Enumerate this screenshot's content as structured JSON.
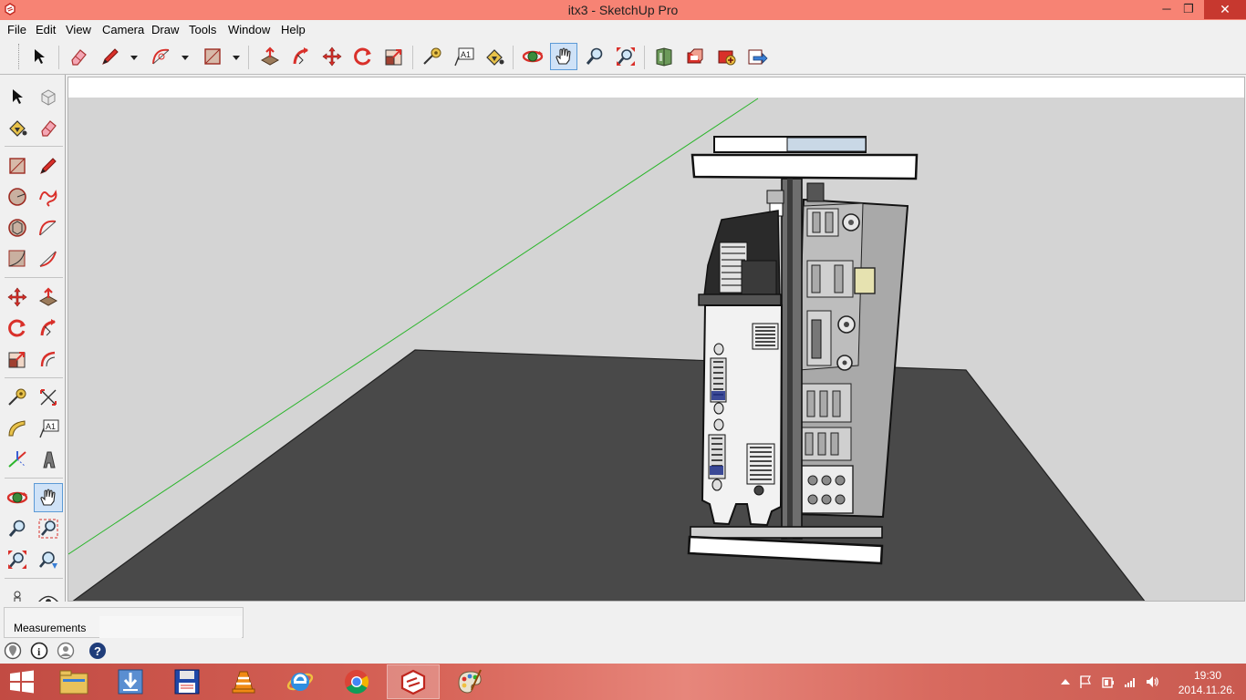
{
  "window": {
    "title": "itx3 - SketchUp Pro",
    "minimize": "─",
    "maximize": "❐",
    "close": "✕"
  },
  "menu": [
    "File",
    "Edit",
    "View",
    "Camera",
    "Draw",
    "Tools",
    "Window",
    "Help"
  ],
  "toolbar": {
    "tools": [
      "select",
      "eraser",
      "line",
      "arc",
      "rectangle",
      "push-pull",
      "follow-me",
      "move",
      "rotate",
      "scale",
      "tape-measure",
      "text",
      "paint-bucket",
      "orbit",
      "pan",
      "zoom",
      "zoom-extents",
      "3d-warehouse",
      "share-model",
      "extension-warehouse",
      "send-to-layout"
    ],
    "active_tool": "pan",
    "text_tool_label": "A1"
  },
  "left_toolbar": {
    "active_tool": "pan",
    "text_tool_label": "A1"
  },
  "measurements": {
    "label": "Measurements",
    "value": ""
  },
  "status_icons": [
    "geo-location",
    "credits",
    "user-account",
    "help"
  ],
  "status_help_glyph": "?",
  "status_credits_glyph": "i",
  "taskbar": {
    "apps": [
      "file-explorer",
      "downloads",
      "save-disk",
      "vlc",
      "internet-explorer",
      "chrome",
      "sketchup",
      "paint"
    ],
    "active_app": "sketchup",
    "time": "19:30",
    "date": "2014.11.26."
  },
  "colors": {
    "titlebar": "#f78374",
    "close_button": "#c7382f",
    "viewport_sky": "#d4d4d4",
    "ground": "#4a4a4a",
    "green_axis": "#2bb52b"
  }
}
